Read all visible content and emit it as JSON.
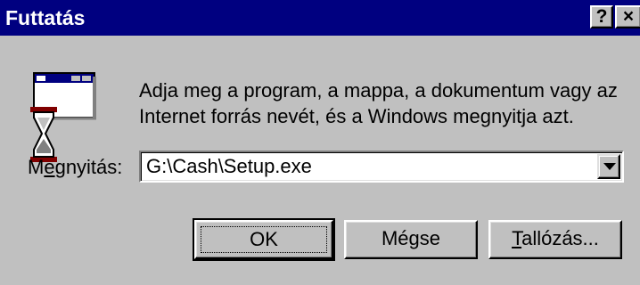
{
  "window": {
    "title": "Futtatás",
    "help_label": "?",
    "close_label": "×"
  },
  "description": {
    "line1": "Adja meg a program, a mappa, a dokumentum vagy az",
    "line2": "Internet forrás nevét, és a Windows megnyitja azt."
  },
  "open": {
    "label_prefix": "M",
    "label_mnemonic": "e",
    "label_suffix": "gnyitás:",
    "value": "G:\\Cash\\Setup.exe"
  },
  "buttons": {
    "ok_label": "OK",
    "cancel_label": "Mégse",
    "browse_mnemonic": "T",
    "browse_rest": "allózás..."
  },
  "icons": {
    "run": "run-program-icon",
    "dropdown": "chevron-down-icon"
  },
  "colors": {
    "titlebar": "#000080",
    "face": "#c0c0c0"
  }
}
